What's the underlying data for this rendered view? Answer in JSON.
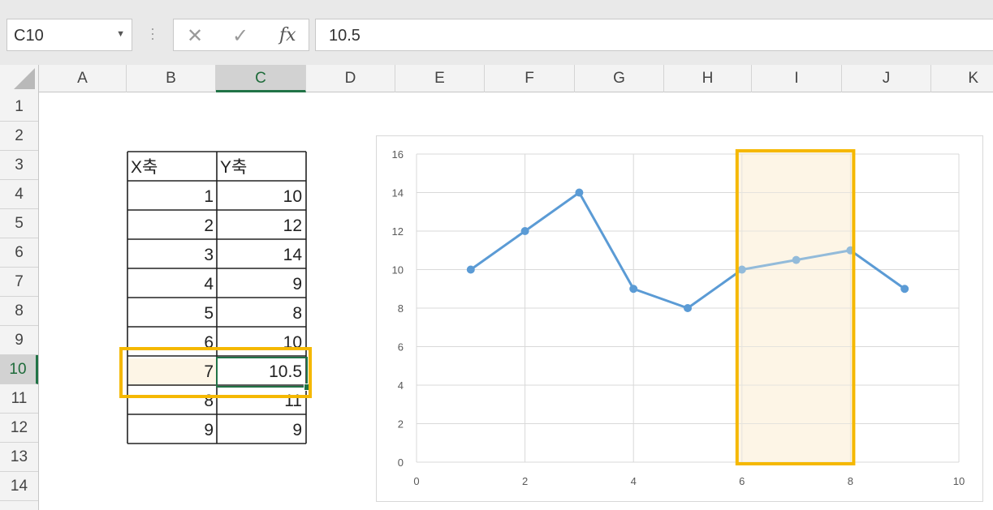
{
  "formula_bar": {
    "name_box": "C10",
    "formula_value": "10.5"
  },
  "columns": [
    "A",
    "B",
    "C",
    "D",
    "E",
    "F",
    "G",
    "H",
    "I",
    "J",
    "K"
  ],
  "rows": [
    "1",
    "2",
    "3",
    "4",
    "5",
    "6",
    "7",
    "8",
    "9",
    "10",
    "11",
    "12",
    "13",
    "14"
  ],
  "selected": {
    "column": "C",
    "row": "10"
  },
  "table": {
    "header": [
      "X축",
      "Y축"
    ],
    "rows": [
      [
        "1",
        "10"
      ],
      [
        "2",
        "12"
      ],
      [
        "3",
        "14"
      ],
      [
        "4",
        "9"
      ],
      [
        "5",
        "8"
      ],
      [
        "6",
        "10"
      ],
      [
        "7",
        "10.5"
      ],
      [
        "8",
        "11"
      ],
      [
        "9",
        "9"
      ]
    ]
  },
  "colors": {
    "series": "#5b9bd5",
    "highlight_border": "#f5b800",
    "highlight_fill": "#fdf5e6",
    "selection": "#217346"
  },
  "chart_data": {
    "type": "scatter",
    "x": [
      1,
      2,
      3,
      4,
      5,
      6,
      7,
      8,
      9
    ],
    "series": [
      {
        "values": [
          10,
          12,
          14,
          9,
          8,
          10,
          10.5,
          11,
          9
        ]
      }
    ],
    "xlim": [
      0,
      10
    ],
    "ylim": [
      0,
      16
    ],
    "xticks": [
      "0",
      "2",
      "4",
      "6",
      "8",
      "10"
    ],
    "yticks": [
      "0",
      "2",
      "4",
      "6",
      "8",
      "10",
      "12",
      "14",
      "16"
    ],
    "grid": true,
    "highlight_x_range": [
      6,
      8
    ],
    "lines": true
  }
}
